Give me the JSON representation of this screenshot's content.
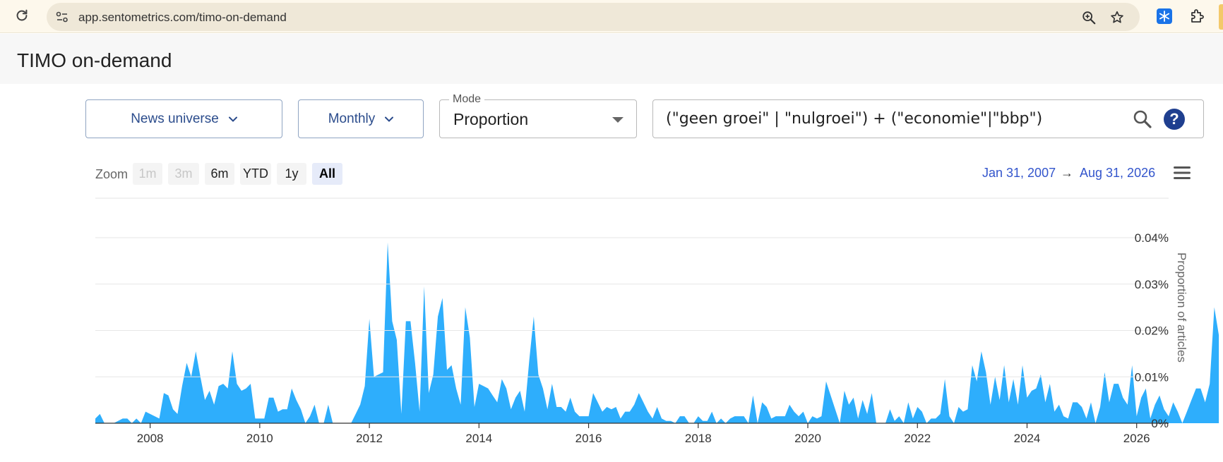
{
  "browser": {
    "url": "app.sentometrics.com/timo-on-demand"
  },
  "header": {
    "title": "TIMO on-demand"
  },
  "controls": {
    "universe_label": "News universe",
    "frequency_label": "Monthly",
    "mode_legend": "Mode",
    "mode_value": "Proportion",
    "query_value": "(\"geen groei\" | \"nulgroei\") + (\"economie\"|\"bbp\")",
    "help_label": "?"
  },
  "zoom": {
    "label": "Zoom",
    "buttons": [
      "1m",
      "3m",
      "6m",
      "YTD",
      "1y",
      "All"
    ],
    "active": "All"
  },
  "range": {
    "from": "Jan 31, 2007",
    "arrow": "→",
    "to": "Aug 31, 2026"
  },
  "colors": {
    "series": "#2eaefc",
    "accent": "#2b4c8c",
    "link": "#3355cc"
  },
  "chart_data": {
    "type": "area",
    "ylabel": "Proportion of articles",
    "y_unit": "%",
    "ylim": [
      0,
      0.04
    ],
    "y_ticks": [
      0,
      0.01,
      0.02,
      0.03,
      0.04
    ],
    "y_tick_labels": [
      "0%",
      "0.01%",
      "0.02%",
      "0.03%",
      "0.04%"
    ],
    "x_start": "2007-01",
    "x_end": "2026-08",
    "x_tick_labels": [
      "2008",
      "2010",
      "2012",
      "2014",
      "2016",
      "2018",
      "2020",
      "2022",
      "2024",
      "2026"
    ],
    "grid": true,
    "series": [
      {
        "values": [
          0.001,
          0.002,
          0,
          0,
          0,
          0.0005,
          0.001,
          0.001,
          0,
          0.001,
          0,
          0.0025,
          0.002,
          0.0015,
          0.001,
          0.0065,
          0.006,
          0.003,
          0.002,
          0.008,
          0.013,
          0.01,
          0.0155,
          0.01,
          0.005,
          0.007,
          0.004,
          0.008,
          0.0085,
          0.0075,
          0.0155,
          0.0085,
          0.007,
          0.0075,
          0.0085,
          0.001,
          0.001,
          0.001,
          0.0055,
          0.0055,
          0.0025,
          0.003,
          0.003,
          0.0075,
          0.005,
          0.003,
          0,
          0.0015,
          0.004,
          0,
          0,
          0.004,
          0,
          0,
          0,
          0,
          0,
          0.002,
          0.004,
          0.008,
          0.0225,
          0.01,
          0.0105,
          0.011,
          0.039,
          0.022,
          0.018,
          0.002,
          0.022,
          0.022,
          0.013,
          0.0025,
          0.0295,
          0.0065,
          0.0105,
          0.023,
          0.027,
          0.0115,
          0.0125,
          0.0075,
          0.004,
          0.025,
          0.0185,
          0.0035,
          0.0085,
          0.008,
          0.0075,
          0.006,
          0.0045,
          0.0095,
          0.0075,
          0.003,
          0.0055,
          0.007,
          0.0025,
          0.0135,
          0.023,
          0.0105,
          0.0075,
          0.003,
          0.0085,
          0.0035,
          0.0035,
          0.0025,
          0.0055,
          0.0025,
          0.0015,
          0.0015,
          0.0015,
          0.0065,
          0.0045,
          0.0025,
          0.0035,
          0.003,
          0.0035,
          0.001,
          0.0025,
          0.0025,
          0.004,
          0.0065,
          0.0045,
          0.0025,
          0.001,
          0.0035,
          0.001,
          0.0005,
          0.0005,
          0,
          0.0015,
          0.0015,
          0,
          0,
          0.0015,
          0.0005,
          0.0005,
          0.0025,
          0,
          0.001,
          0,
          0.001,
          0.0015,
          0.0015,
          0.0015,
          0,
          0.006,
          0,
          0.0045,
          0.0035,
          0.001,
          0.0015,
          0.0015,
          0.0015,
          0.004,
          0.0025,
          0.0015,
          0.0025,
          0,
          0.0015,
          0.001,
          0.0015,
          0.009,
          0.006,
          0.003,
          0,
          0.007,
          0.004,
          0.0055,
          0.001,
          0.005,
          0.002,
          0.0065,
          0,
          0,
          0,
          0.003,
          0.0005,
          0.0015,
          0,
          0.0045,
          0.001,
          0.0035,
          0.0025,
          0,
          0.001,
          0.001,
          0.002,
          0.0095,
          0.0015,
          0,
          0.0035,
          0.0025,
          0.003,
          0.0125,
          0.009,
          0.0155,
          0.011,
          0.004,
          0.01,
          0.005,
          0.0125,
          0.0045,
          0.0095,
          0.004,
          0.0125,
          0.0055,
          0.007,
          0.0075,
          0.0105,
          0.0045,
          0.0085,
          0.0025,
          0.004,
          0.0015,
          0.001,
          0.0045,
          0.0045,
          0.0035,
          0.001,
          0.0045,
          0,
          0.0035,
          0.011,
          0.0045,
          0.0085,
          0.0085,
          0.0055,
          0.004,
          0.0125,
          0.0015,
          0.0055,
          0.0075,
          0.001,
          0.004,
          0.006,
          0.003,
          0.0015,
          0.0045,
          0.0025,
          0,
          0.0025,
          0.005,
          0.0075,
          0.0075,
          0.0045,
          0.0085,
          0.025,
          0.019
        ]
      }
    ]
  }
}
